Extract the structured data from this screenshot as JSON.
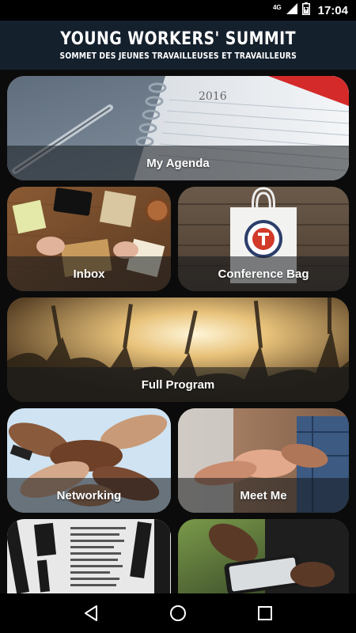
{
  "status_bar": {
    "network": "4G",
    "time": "17:04",
    "icons": [
      "signal-icon",
      "battery-icon"
    ]
  },
  "header": {
    "title": "YOUNG WORKERS' SUMMIT",
    "subtitle": "SOMMET DES JEUNES TRAVAILLEUSES ET TRAVAILLEURS"
  },
  "tiles": [
    {
      "label": "My Agenda",
      "art": "agenda-photo",
      "art_text": "2016"
    },
    {
      "label": "Inbox",
      "art": "desk-notes-photo"
    },
    {
      "label": "Conference Bag",
      "art": "tote-bag-photo"
    },
    {
      "label": "Full Program",
      "art": "concert-crowd-photo"
    },
    {
      "label": "Networking",
      "art": "joined-hands-photo"
    },
    {
      "label": "Meet Me",
      "art": "handshake-photo"
    },
    {
      "label": "",
      "art": "newspapers-photo"
    },
    {
      "label": "",
      "art": "smartphone-hands-photo"
    }
  ],
  "nav_bar": {
    "icons": [
      "back-icon",
      "home-icon",
      "recents-icon"
    ]
  },
  "colors": {
    "header_bg": "#15202d",
    "label_bar_bg": "rgba(20,24,28,0.55)",
    "page_bg": "#0b0b0b"
  }
}
